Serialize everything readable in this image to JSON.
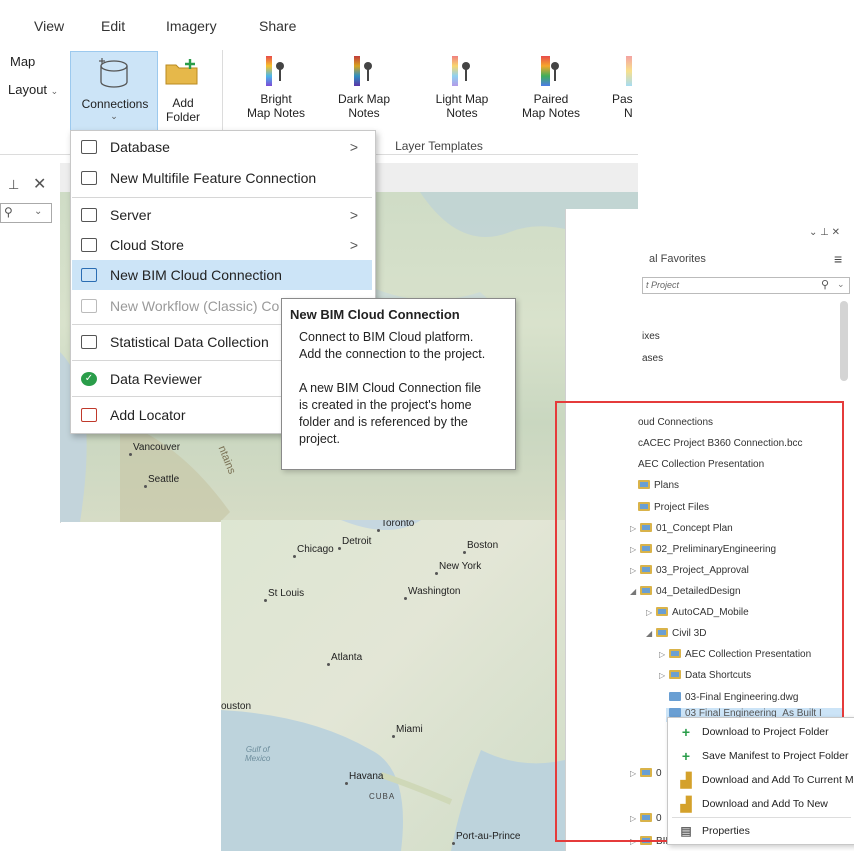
{
  "ribbon": {
    "tabs": [
      "View",
      "Edit",
      "Imagery",
      "Share"
    ],
    "left_labels": [
      "Map",
      "Layout"
    ],
    "connections_label": "Connections",
    "add_folder_label": [
      "Add",
      "Folder"
    ],
    "templates": [
      {
        "line1": "Bright",
        "line2": "Map Notes"
      },
      {
        "line1": "Dark Map",
        "line2": "Notes"
      },
      {
        "line1": "Light Map",
        "line2": "Notes"
      },
      {
        "line1": "Paired",
        "line2": "Map Notes"
      },
      {
        "line1": "Pas",
        "line2": "N"
      }
    ],
    "group_label": "Layer Templates"
  },
  "connections_menu": {
    "items": [
      {
        "label": "Database",
        "submenu": ">",
        "icon": "database-icon"
      },
      {
        "label": "New Multifile Feature Connection",
        "icon": "multifile-icon"
      },
      {
        "label": "Server",
        "submenu": ">",
        "icon": "server-icon"
      },
      {
        "label": "Cloud Store",
        "submenu": ">",
        "icon": "cloud-store-icon"
      },
      {
        "label": "New BIM Cloud Connection",
        "icon": "bim-cloud-icon"
      },
      {
        "label": "New Workflow (Classic) Co",
        "icon": "workflow-icon"
      },
      {
        "label": "Statistical Data Collection",
        "icon": "statistics-icon"
      },
      {
        "label": "Data Reviewer",
        "icon": "check-icon"
      },
      {
        "label": "Add Locator",
        "icon": "locator-icon"
      }
    ]
  },
  "tooltip": {
    "title": "New BIM Cloud Connection",
    "line1": "Connect to BIM Cloud platform.",
    "line2": "Add the connection to the project.",
    "line3": "A new BIM Cloud Connection file",
    "line4": "is created in the project's home",
    "line5": "folder and is referenced by the",
    "line6": "project."
  },
  "map1": {
    "cities": [
      "Vancouver",
      "Seattle"
    ],
    "terrain": "ntains"
  },
  "map2": {
    "cities": [
      "Toronto",
      "Chicago",
      "Detroit",
      "Boston",
      "New York",
      "St Louis",
      "Washington",
      "Atlanta",
      "ouston",
      "Miami",
      "Havana",
      "CUBA",
      "Port-au-Prince"
    ],
    "water": [
      "Gulf of",
      "Mexico"
    ]
  },
  "catalog": {
    "pin_controls": "⌄ ⊥ ✕",
    "tabs": "al  Favorites",
    "search_placeholder": "t Project",
    "partial_items": [
      "ixes",
      "ases"
    ],
    "tree": [
      "oud Connections",
      "cACEC Project B360 Connection.bcc",
      "AEC Collection Presentation",
      "Plans",
      "Project Files",
      "01_Concept Plan",
      "02_PreliminaryEngineering",
      "03_Project_Approval",
      "04_DetailedDesign",
      "AutoCAD_Mobile",
      "Civil 3D",
      "AEC Collection Presentation",
      "Data Shortcuts",
      "03-Final Engineering.dwg",
      "03 Final Engineering_As Built I"
    ],
    "bottom_partial": [
      "0",
      "0",
      "BID Folder"
    ]
  },
  "context_menu": {
    "items": [
      {
        "label": "Download to Project Folder",
        "icon": "plus-icon"
      },
      {
        "label": "Save Manifest to Project Folder",
        "icon": "plus-icon"
      },
      {
        "label": "Download and Add To Current M",
        "icon": "download-add-icon"
      },
      {
        "label": "Download and Add To New",
        "icon": "download-add-icon"
      },
      {
        "label": "Properties",
        "icon": "properties-icon"
      }
    ]
  },
  "colors": {
    "highlight": "#cce4f7",
    "accent": "#1e70c6",
    "red_box": "#e53b3b",
    "green": "#2a9d4a"
  }
}
